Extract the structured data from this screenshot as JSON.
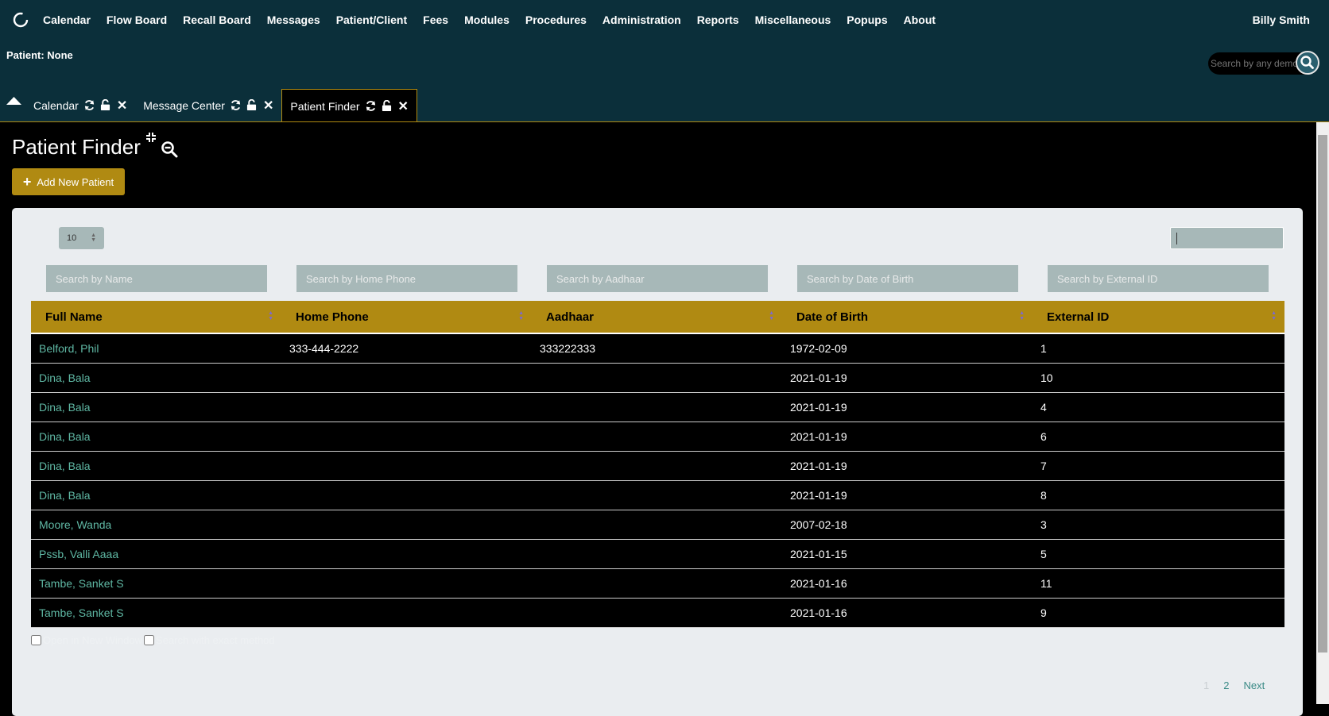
{
  "navbar": {
    "menu": [
      "Calendar",
      "Flow Board",
      "Recall Board",
      "Messages",
      "Patient/Client",
      "Fees",
      "Modules",
      "Procedures",
      "Administration",
      "Reports",
      "Miscellaneous",
      "Popups",
      "About"
    ],
    "user": "Billy Smith",
    "patient_label": "Patient: None",
    "global_search_placeholder": "Search by any demographics"
  },
  "tabs": [
    {
      "label": "Calendar",
      "active": false
    },
    {
      "label": "Message Center",
      "active": false
    },
    {
      "label": "Patient Finder",
      "active": true
    }
  ],
  "page": {
    "title": "Patient Finder",
    "add_button": "Add New Patient"
  },
  "table_controls": {
    "page_length": "10",
    "search_value": ""
  },
  "column_search": [
    "Search by Name",
    "Search by Home Phone",
    "Search by Aadhaar",
    "Search by Date of Birth",
    "Search by External ID"
  ],
  "columns": [
    "Full Name",
    "Home Phone",
    "Aadhaar",
    "Date of Birth",
    "External ID"
  ],
  "rows": [
    {
      "name": "Belford, Phil",
      "phone": "333-444-2222",
      "aadhaar": "333222333",
      "dob": "1972-02-09",
      "ext_id": "1"
    },
    {
      "name": "Dina, Bala",
      "phone": "",
      "aadhaar": "",
      "dob": "2021-01-19",
      "ext_id": "10"
    },
    {
      "name": "Dina, Bala",
      "phone": "",
      "aadhaar": "",
      "dob": "2021-01-19",
      "ext_id": "4"
    },
    {
      "name": "Dina, Bala",
      "phone": "",
      "aadhaar": "",
      "dob": "2021-01-19",
      "ext_id": "6"
    },
    {
      "name": "Dina, Bala",
      "phone": "",
      "aadhaar": "",
      "dob": "2021-01-19",
      "ext_id": "7"
    },
    {
      "name": "Dina, Bala",
      "phone": "",
      "aadhaar": "",
      "dob": "2021-01-19",
      "ext_id": "8"
    },
    {
      "name": "Moore, Wanda",
      "phone": "",
      "aadhaar": "",
      "dob": "2007-02-18",
      "ext_id": "3"
    },
    {
      "name": "Pssb, Valli Aaaa",
      "phone": "",
      "aadhaar": "",
      "dob": "2021-01-15",
      "ext_id": "5"
    },
    {
      "name": "Tambe, Sanket S",
      "phone": "",
      "aadhaar": "",
      "dob": "2021-01-16",
      "ext_id": "11"
    },
    {
      "name": "Tambe, Sanket S",
      "phone": "",
      "aadhaar": "",
      "dob": "2021-01-16",
      "ext_id": "9"
    }
  ],
  "footer": {
    "open_new_window": "Open in New Window",
    "exact_search": "Search with exact method",
    "pages": [
      "1",
      "2"
    ],
    "next": "Next"
  },
  "colors": {
    "navbar_bg": "#0b2f3a",
    "accent": "#b08a12",
    "link": "#5fb8a4",
    "panel_bg": "#eaedf0",
    "input_bg": "#a7b8b8"
  },
  "icons": [
    "logo-icon",
    "search-icon",
    "chevron-up-icon",
    "refresh-icon",
    "unlock-icon",
    "close-icon",
    "expand-icon",
    "zoom-out-icon",
    "plus-icon"
  ]
}
